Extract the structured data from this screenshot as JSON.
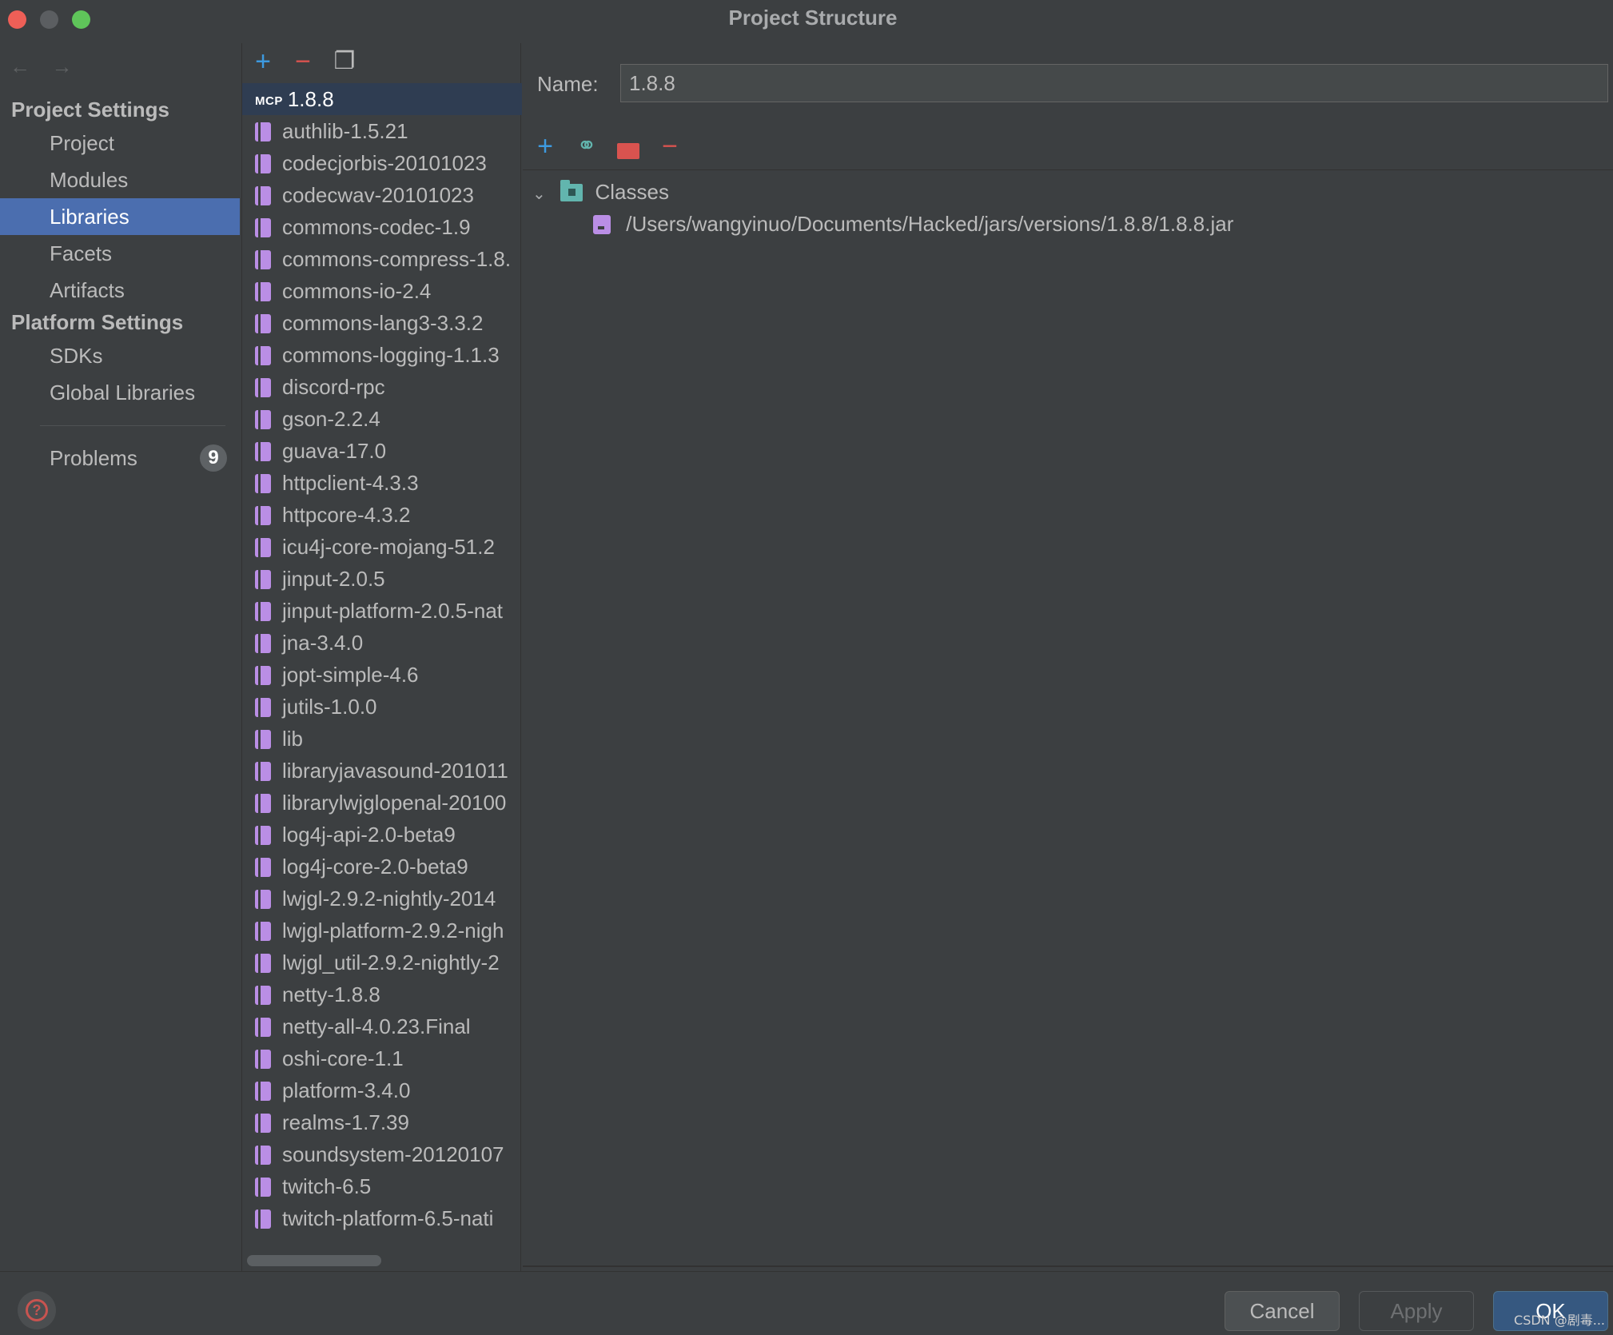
{
  "window": {
    "title": "Project Structure"
  },
  "sidebar": {
    "project_settings_heading": "Project Settings",
    "platform_settings_heading": "Platform Settings",
    "items": [
      {
        "label": "Project"
      },
      {
        "label": "Modules"
      },
      {
        "label": "Libraries",
        "selected": true
      },
      {
        "label": "Facets"
      },
      {
        "label": "Artifacts"
      },
      {
        "label": "SDKs"
      },
      {
        "label": "Global Libraries"
      }
    ],
    "problems": {
      "label": "Problems",
      "count": "9"
    }
  },
  "library_list": {
    "selected_prefix": "MCP",
    "items": [
      "1.8.8",
      "authlib-1.5.21",
      "codecjorbis-20101023",
      "codecwav-20101023",
      "commons-codec-1.9",
      "commons-compress-1.8.",
      "commons-io-2.4",
      "commons-lang3-3.3.2",
      "commons-logging-1.1.3",
      "discord-rpc",
      "gson-2.2.4",
      "guava-17.0",
      "httpclient-4.3.3",
      "httpcore-4.3.2",
      "icu4j-core-mojang-51.2",
      "jinput-2.0.5",
      "jinput-platform-2.0.5-nat",
      "jna-3.4.0",
      "jopt-simple-4.6",
      "jutils-1.0.0",
      "lib",
      "libraryjavasound-201011",
      "librarylwjglopenal-20100",
      "log4j-api-2.0-beta9",
      "log4j-core-2.0-beta9",
      "lwjgl-2.9.2-nightly-2014",
      "lwjgl-platform-2.9.2-nigh",
      "lwjgl_util-2.9.2-nightly-2",
      "netty-1.8.8",
      "netty-all-4.0.23.Final",
      "oshi-core-1.1",
      "platform-3.4.0",
      "realms-1.7.39",
      "soundsystem-20120107",
      "twitch-6.5",
      "twitch-platform-6.5-nati"
    ]
  },
  "detail": {
    "name_label": "Name:",
    "name_value": "1.8.8",
    "classes_label": "Classes",
    "class_path": "/Users/wangyinuo/Documents/Hacked/jars/versions/1.8.8/1.8.8.jar"
  },
  "buttons": {
    "cancel": "Cancel",
    "apply": "Apply",
    "ok": "OK"
  },
  "watermark": "CSDN @剧毒...",
  "icons": {
    "add": "+",
    "remove": "−",
    "copy": "❐",
    "link": "⚭",
    "back": "←",
    "forward": "→",
    "chevron": "⌄",
    "help": "?"
  },
  "colors": {
    "selection": "#4b6eaf",
    "accent_plus": "#3d9ae0",
    "accent_minus": "#d9534f",
    "jar_icon": "#ba8ee5"
  }
}
